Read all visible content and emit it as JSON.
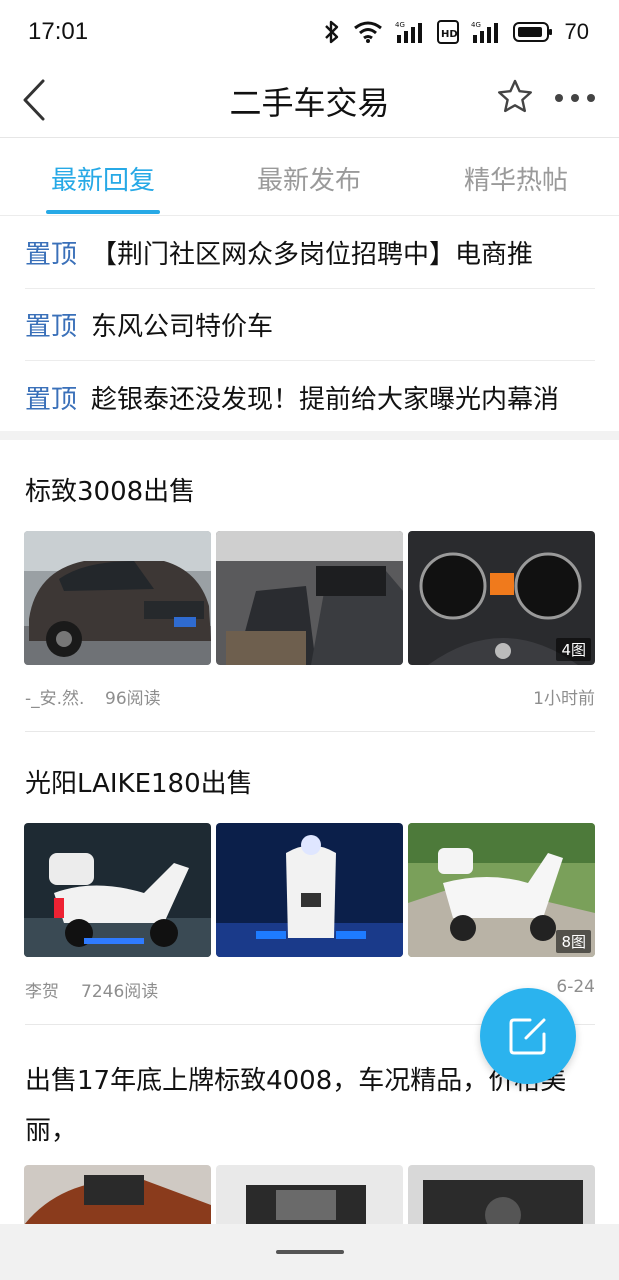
{
  "status_bar": {
    "time": "17:01",
    "icons": [
      "bluetooth-icon",
      "wifi-icon",
      "signal-4g-icon",
      "hd-icon",
      "signal-4g-icon",
      "battery-icon"
    ],
    "battery": "70"
  },
  "header": {
    "title": "二手车交易",
    "back_icon": "chevron-left-icon",
    "star_icon": "star-icon",
    "more_icon": "more-dots-icon"
  },
  "tabs": {
    "items": [
      "最新回复",
      "最新发布",
      "精华热帖"
    ],
    "active": "最新回复",
    "accent": "#27a9e6"
  },
  "pinned": {
    "tag": "置顶",
    "tag_color": "#3a70b9",
    "items": [
      "【荆门社区网众多岗位招聘中】电商推",
      "东风公司特价车",
      "趁银泰还没发现！提前给大家曝光内幕消"
    ]
  },
  "posts": [
    {
      "title": "标致3008出售",
      "image_count": "4图",
      "author": "-_安.然.",
      "reads": "96阅读",
      "time": "1小时前"
    },
    {
      "title": "光阳LAIKE180出售",
      "image_count": "8图",
      "author": "李贺",
      "reads": "7246阅读",
      "time": "6-24"
    },
    {
      "title": "出售17年底上牌标致4008，车况精品，价格美丽，"
    }
  ],
  "fab": {
    "icon": "compose-icon",
    "color": "#2bb3ee"
  }
}
